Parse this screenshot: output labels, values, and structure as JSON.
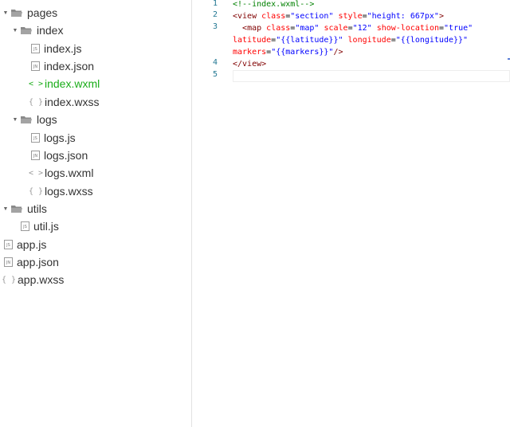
{
  "tree": [
    {
      "label": "pages",
      "kind": "folder"
    },
    {
      "label": "index",
      "kind": "folder"
    },
    {
      "label": "index.js",
      "kind": "file",
      "icon": "JS"
    },
    {
      "label": "index.json",
      "kind": "file",
      "icon": "JN"
    },
    {
      "label": "index.wxml",
      "kind": "file",
      "icon": "< >"
    },
    {
      "label": "index.wxss",
      "kind": "file",
      "icon": "{ }"
    },
    {
      "label": "logs",
      "kind": "folder"
    },
    {
      "label": "logs.js",
      "kind": "file",
      "icon": "JS"
    },
    {
      "label": "logs.json",
      "kind": "file",
      "icon": "JN"
    },
    {
      "label": "logs.wxml",
      "kind": "file",
      "icon": "< >"
    },
    {
      "label": "logs.wxss",
      "kind": "file",
      "icon": "{ }"
    },
    {
      "label": "utils",
      "kind": "folder"
    },
    {
      "label": "util.js",
      "kind": "file",
      "icon": "JS"
    },
    {
      "label": "app.js",
      "kind": "file",
      "icon": "JS"
    },
    {
      "label": "app.json",
      "kind": "file",
      "icon": "JN"
    },
    {
      "label": "app.wxss",
      "kind": "file",
      "icon": "{ }"
    }
  ],
  "active_file": "index.wxml",
  "colors": {
    "accent": "#1aad19",
    "line_number": "#237893"
  },
  "editor": {
    "line_numbers": [
      "1",
      "2",
      "3",
      "4",
      "5"
    ],
    "lines": [
      {
        "tokens": [
          {
            "t": "comment",
            "v": "<!--index.wxml-->"
          }
        ]
      },
      {
        "tokens": [
          {
            "t": "tag",
            "v": "<view"
          },
          {
            "t": "plain",
            "v": " "
          },
          {
            "t": "attr",
            "v": "class"
          },
          {
            "t": "plain",
            "v": "="
          },
          {
            "t": "val",
            "v": "\"section\""
          },
          {
            "t": "plain",
            "v": " "
          },
          {
            "t": "attr",
            "v": "style"
          },
          {
            "t": "plain",
            "v": "="
          },
          {
            "t": "val",
            "v": "\"height: 667px\""
          },
          {
            "t": "tag",
            "v": ">"
          }
        ]
      },
      {
        "tokens": [
          {
            "t": "plain",
            "v": "  "
          },
          {
            "t": "tag",
            "v": "<map"
          },
          {
            "t": "plain",
            "v": " "
          },
          {
            "t": "attr",
            "v": "class"
          },
          {
            "t": "plain",
            "v": "="
          },
          {
            "t": "val",
            "v": "\"map\""
          },
          {
            "t": "plain",
            "v": " "
          },
          {
            "t": "attr",
            "v": "scale"
          },
          {
            "t": "plain",
            "v": "="
          },
          {
            "t": "val",
            "v": "\"12\""
          },
          {
            "t": "plain",
            "v": " "
          },
          {
            "t": "attr",
            "v": "show-location"
          },
          {
            "t": "plain",
            "v": "="
          },
          {
            "t": "val",
            "v": "\"true\""
          }
        ]
      },
      {
        "tokens": [
          {
            "t": "attr",
            "v": "latitude"
          },
          {
            "t": "plain",
            "v": "="
          },
          {
            "t": "val",
            "v": "\"{{latitude}}\""
          },
          {
            "t": "plain",
            "v": " "
          },
          {
            "t": "attr",
            "v": "longitude"
          },
          {
            "t": "plain",
            "v": "="
          },
          {
            "t": "val",
            "v": "\"{{longitude}}\""
          }
        ]
      },
      {
        "tokens": [
          {
            "t": "attr",
            "v": "markers"
          },
          {
            "t": "plain",
            "v": "="
          },
          {
            "t": "val",
            "v": "\"{{markers}}\""
          },
          {
            "t": "tag",
            "v": "/>"
          }
        ]
      },
      {
        "tokens": [
          {
            "t": "tag",
            "v": "</view>"
          }
        ]
      },
      {
        "tokens": []
      }
    ]
  }
}
